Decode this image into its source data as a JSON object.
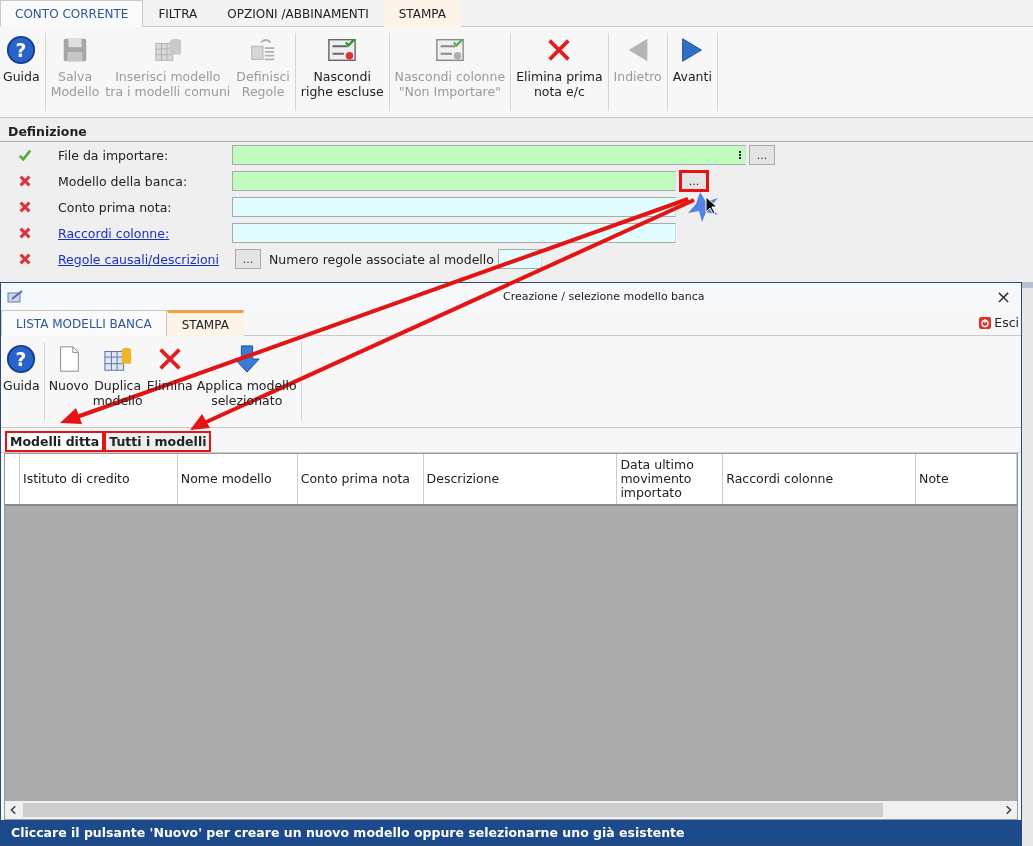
{
  "main_tabs": [
    {
      "label": "CONTO CORRENTE",
      "selected": true,
      "contextual": false
    },
    {
      "label": "FILTRA",
      "selected": false,
      "contextual": false
    },
    {
      "label": "OPZIONI /ABBINAMENTI",
      "selected": false,
      "contextual": false
    },
    {
      "label": "STAMPA",
      "selected": false,
      "contextual": true
    }
  ],
  "toolbar_groups": [
    {
      "buttons": [
        {
          "kind": "help",
          "glyph": "?",
          "label": "Guida",
          "disabled": false
        }
      ]
    },
    {
      "buttons": [
        {
          "kind": "save",
          "label": "Salva\nModello",
          "disabled": true
        },
        {
          "kind": "insert",
          "label": "Inserisci modello\ntra i modelli comuni",
          "disabled": true
        },
        {
          "kind": "rules",
          "label": "Definisci\nRegole",
          "disabled": true
        }
      ]
    },
    {
      "buttons": [
        {
          "kind": "hiderows",
          "label": "Nascondi\nrighe escluse",
          "disabled": false
        }
      ]
    },
    {
      "buttons": [
        {
          "kind": "hidecols",
          "label": "Nascondi colonne\n\"Non Importare\"",
          "disabled": true
        }
      ]
    },
    {
      "buttons": [
        {
          "kind": "delete",
          "label": "Elimina prima\nnota e/c",
          "disabled": false
        }
      ]
    },
    {
      "buttons": [
        {
          "kind": "back",
          "label": "Indietro",
          "disabled": true
        }
      ]
    },
    {
      "buttons": [
        {
          "kind": "forward",
          "label": "Avanti",
          "disabled": false
        }
      ]
    }
  ],
  "definition": {
    "title": "Definizione",
    "rows": [
      {
        "kind": "file",
        "label": "File da importare:",
        "valid": true,
        "link": false,
        "required": true,
        "button": "...",
        "annotated": false
      },
      {
        "kind": "picker",
        "label": "Modello della banca:",
        "valid": false,
        "link": false,
        "required": true,
        "button": "...",
        "annotated": true
      },
      {
        "kind": "input",
        "label": "Conto prima nota:",
        "valid": false,
        "link": false,
        "required": false
      },
      {
        "kind": "input",
        "label": "Raccordi colonne:",
        "valid": false,
        "link": true,
        "required": false
      },
      {
        "kind": "rules",
        "label": "Regole causali/descrizioni",
        "valid": false,
        "link": true,
        "button": "...",
        "count_label": "Numero regole associate al modello"
      }
    ]
  },
  "dialog": {
    "title": "Creazione / selezione modello banca",
    "close": "×",
    "tabs": [
      {
        "label": "LISTA MODELLI BANCA",
        "selected": true,
        "contextual": false
      },
      {
        "label": "STAMPA",
        "selected": false,
        "contextual": true
      }
    ],
    "exit_button": "Esci",
    "toolbar_groups": [
      {
        "buttons": [
          {
            "kind": "help",
            "glyph": "?",
            "label": "Guida",
            "disabled": false
          }
        ]
      },
      {
        "buttons": [
          {
            "kind": "new",
            "label": "Nuovo",
            "disabled": false
          },
          {
            "kind": "duplicate",
            "label": "Duplica\nmodello",
            "disabled": false
          },
          {
            "kind": "delete",
            "label": "Elimina",
            "disabled": false
          },
          {
            "kind": "apply",
            "label": "Applica modello\nselezionato",
            "disabled": false
          }
        ]
      }
    ],
    "subtabs": [
      {
        "label": "Modelli ditta",
        "selected": true,
        "annotated": true
      },
      {
        "label": "Tutti i modelli",
        "selected": false,
        "annotated": true
      }
    ],
    "columns": [
      "Istituto di credito",
      "Nome modello",
      "Conto prima nota",
      "Descrizione",
      "Data ultimo\nmovimento\nimportato",
      "Raccordi colonne",
      "Note"
    ],
    "status_bar": "Cliccare il pulsante 'Nuovo' per creare un nuovo modello oppure selezionarne uno già esistente"
  }
}
